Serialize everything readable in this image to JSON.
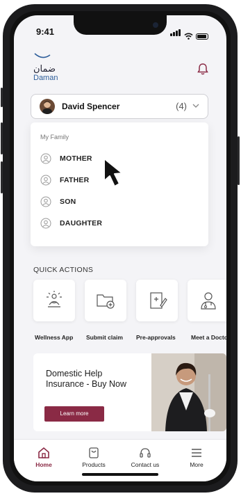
{
  "status": {
    "time": "9:41"
  },
  "brand": {
    "logo_ar": "ضمان",
    "logo_en": "Daman"
  },
  "profile": {
    "name": "David Spencer",
    "count": "(4)"
  },
  "family": {
    "title": "My Family",
    "members": [
      {
        "label": "MOTHER"
      },
      {
        "label": "FATHER"
      },
      {
        "label": "SON"
      },
      {
        "label": "DAUGHTER"
      }
    ]
  },
  "quick_actions": {
    "title": "QUICK ACTIONS",
    "items": [
      {
        "label": "Wellness App",
        "icon": "wellness-icon"
      },
      {
        "label": "Submit claim",
        "icon": "folder-add-icon"
      },
      {
        "label": "Pre-approvals",
        "icon": "document-edit-icon"
      },
      {
        "label": "Meet a Doctor",
        "icon": "doctor-icon"
      }
    ]
  },
  "banner": {
    "text": "Domestic Help Insurance - Buy Now",
    "button": "Learn more"
  },
  "tabs": [
    {
      "label": "Home",
      "icon": "home-icon",
      "active": true
    },
    {
      "label": "Products",
      "icon": "products-icon"
    },
    {
      "label": "Contact us",
      "icon": "contact-icon"
    },
    {
      "label": "More",
      "icon": "menu-icon"
    }
  ],
  "colors": {
    "accent": "#8a2a45",
    "brand_blue": "#2d5d9a",
    "screen_bg": "#f4f4f7"
  }
}
